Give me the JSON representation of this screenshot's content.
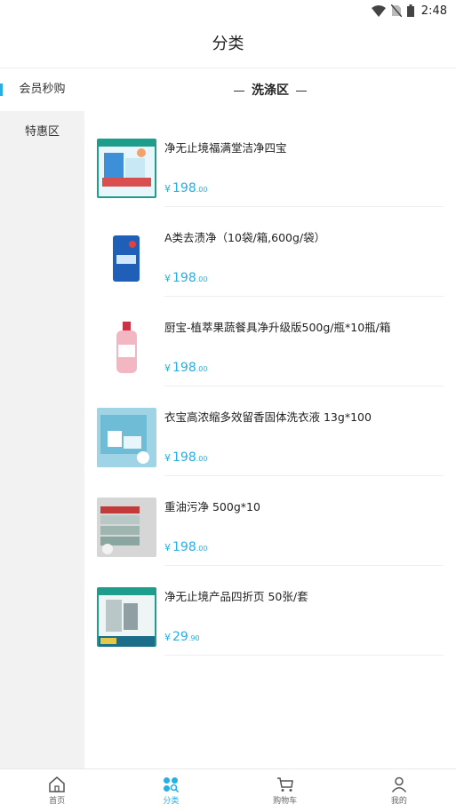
{
  "status": {
    "time": "2:48"
  },
  "header": {
    "title": "分类"
  },
  "sidebar": {
    "items": [
      {
        "label": "会员秒购"
      },
      {
        "label": "特惠区"
      }
    ]
  },
  "section": {
    "title": "洗涤区"
  },
  "products": [
    {
      "name": "净无止境福满堂洁净四宝",
      "currency": "¥",
      "price_int": "198",
      "price_dec": ".00"
    },
    {
      "name": "A类去渍净（10袋/箱,600g/袋）",
      "currency": "¥",
      "price_int": "198",
      "price_dec": ".00"
    },
    {
      "name": "厨宝-植萃果蔬餐具净升级版500g/瓶*10瓶/箱",
      "currency": "¥",
      "price_int": "198",
      "price_dec": ".00"
    },
    {
      "name": "衣宝高浓缩多效留香固体洗衣液 13g*100",
      "currency": "¥",
      "price_int": "198",
      "price_dec": ".00"
    },
    {
      "name": "重油污净 500g*10",
      "currency": "¥",
      "price_int": "198",
      "price_dec": ".00"
    },
    {
      "name": "净无止境产品四折页  50张/套",
      "currency": "¥",
      "price_int": "29",
      "price_dec": ".90"
    }
  ],
  "tabbar": {
    "items": [
      {
        "label": "首页"
      },
      {
        "label": "分类"
      },
      {
        "label": "购物车"
      },
      {
        "label": "我的"
      }
    ]
  },
  "colors": {
    "accent": "#26aee6",
    "sidebar_bg": "#f2f2f2"
  }
}
